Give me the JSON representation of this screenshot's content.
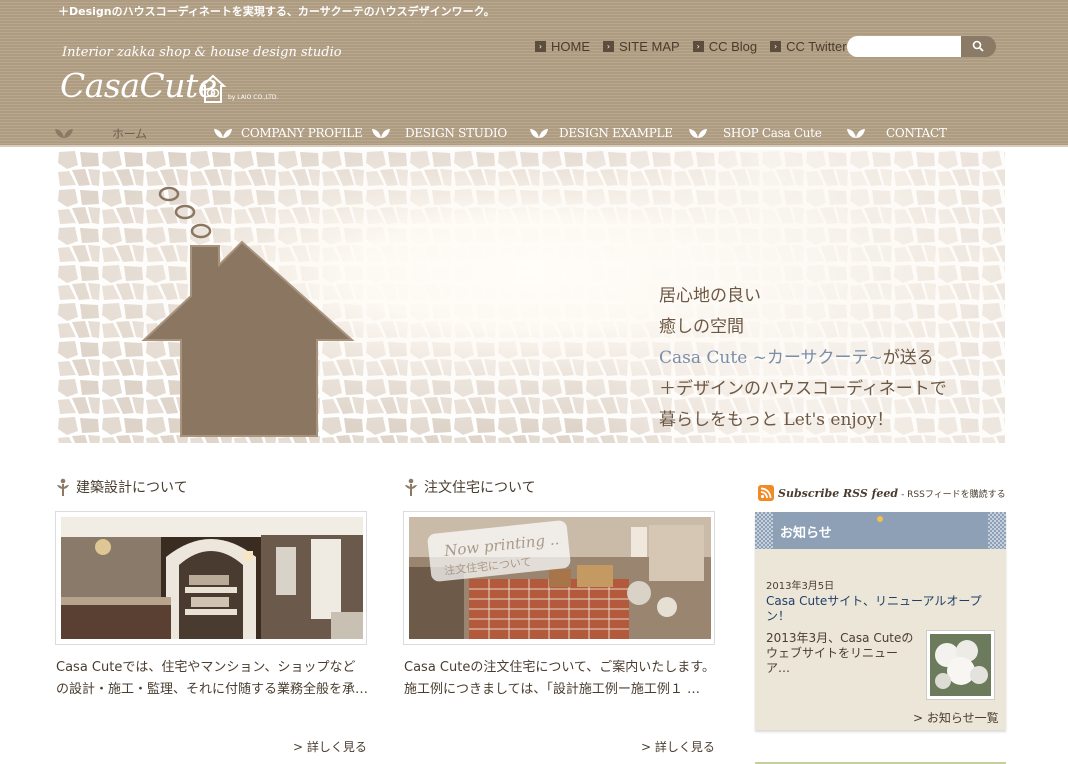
{
  "header": {
    "tagline": "＋Designのハウスコーディネートを実現する、カーサクーテのハウスデザインワーク。",
    "logo_sub": "Interior zakka shop & house design studio",
    "logo_main": "CasaCute",
    "logo_by": "by LAIO CO.,LTD."
  },
  "util_nav": [
    {
      "label": "HOME"
    },
    {
      "label": "SITE MAP"
    },
    {
      "label": "CC Blog"
    },
    {
      "label": "CC Twitter"
    }
  ],
  "search": {
    "placeholder": "",
    "value": "",
    "icon": "magnifier-icon"
  },
  "global_nav": [
    {
      "label": "ホーム",
      "active": true
    },
    {
      "label": "COMPANY PROFILE"
    },
    {
      "label": "DESIGN STUDIO"
    },
    {
      "label": "DESIGN EXAMPLE"
    },
    {
      "label": "SHOP Casa Cute"
    },
    {
      "label": "CONTACT"
    }
  ],
  "hero": {
    "line1": "居心地の良い",
    "line2": "癒しの空間",
    "line3_accent": "Casa Cute ~カーサクーテ~",
    "line3_rest": "が送る",
    "line4": "＋デザインのハウスコーディネートで",
    "line5": "暮らしをもっと Let's enjoy！"
  },
  "columns": [
    {
      "title": "建築設計について",
      "excerpt": "Casa Cuteでは、住宅やマンション、ショップなどの設計・施工・監理、それに付随する業務全般を承…",
      "more": "> 詳しく見る"
    },
    {
      "title": "注文住宅について",
      "photo_overlay_en": "Now printing ..",
      "photo_overlay_jp": "注文住宅について",
      "excerpt": "Casa Cuteの注文住宅について、ご案内いたします。施工例につきましては、「設計施工例ー施工例１ …",
      "more": "> 詳しく見る"
    }
  ],
  "sidebar": {
    "rss_en": "Subscribe RSS feed",
    "rss_jp": "- RSSフィードを購読する",
    "news_title": "お知らせ",
    "news_date": "2013年3月5日",
    "news_link": "Casa Cuteサイト、リニューアルオープン！",
    "news_body": "2013年3月、Casa Cuteのウェブサイトをリニューア…",
    "news_more": "> お知らせ一覧"
  },
  "colors": {
    "header_bg": "#b5a287",
    "house": "#8b7661",
    "accent_blue": "#7a8ea8",
    "news_head": "#8ea0b6",
    "rss_orange": "#f08a24"
  }
}
